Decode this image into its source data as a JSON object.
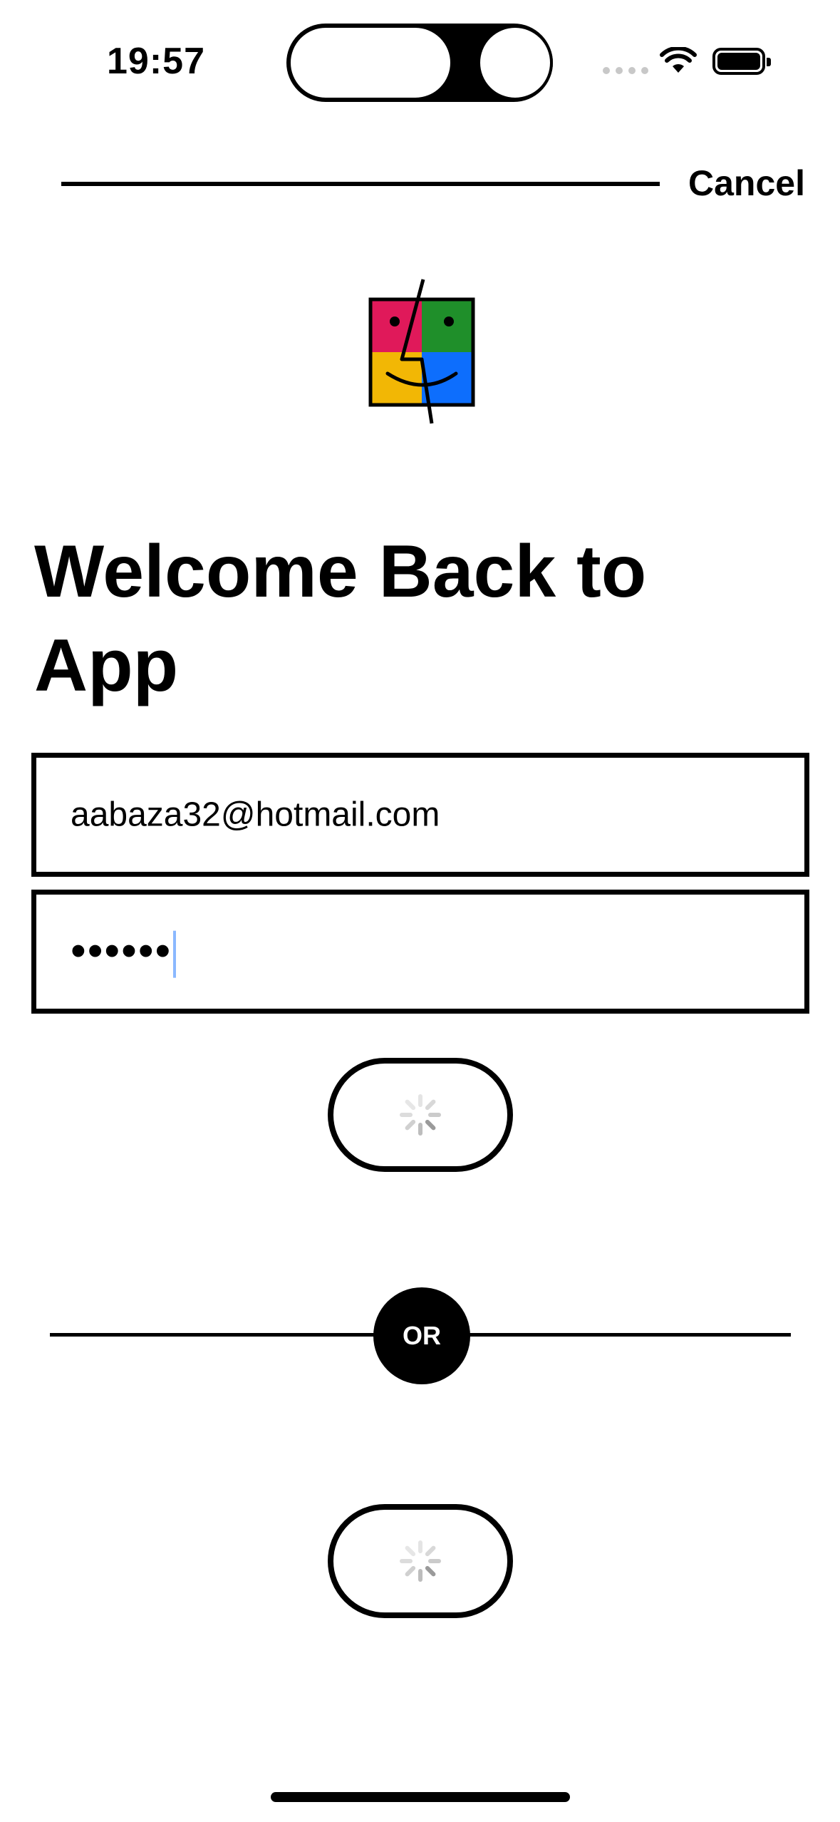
{
  "status_bar": {
    "time": "19:57",
    "icons": [
      "cellular-signal-icon",
      "wifi-icon",
      "battery-icon"
    ]
  },
  "nav": {
    "cancel_label": "Cancel"
  },
  "logo": {
    "icon": "finder-face-logo",
    "colors": [
      "#e0195a",
      "#1f8f2a",
      "#f2b705",
      "#0d6efd"
    ]
  },
  "title": "Welcome Back to App",
  "form": {
    "email_value": "aabaza32@hotmail.com",
    "password_value": "••••••"
  },
  "buttons": {
    "primary_state": "loading",
    "secondary_state": "loading"
  },
  "divider": {
    "label": "OR"
  }
}
